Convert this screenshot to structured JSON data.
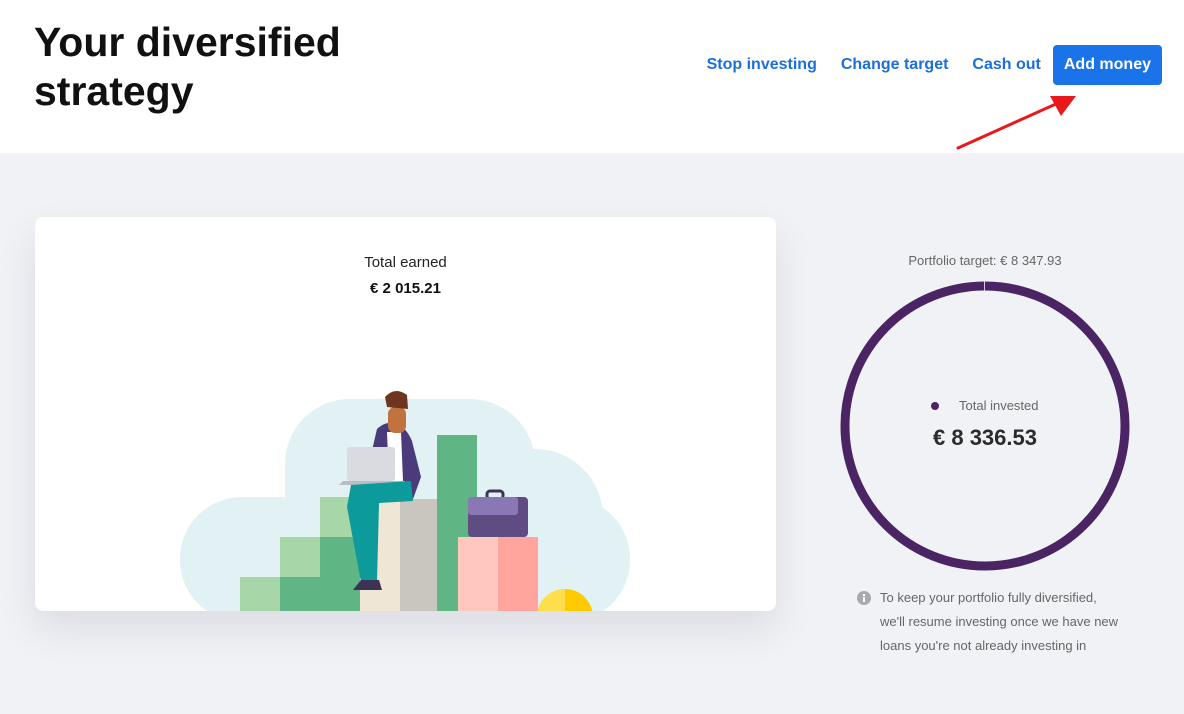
{
  "header": {
    "title": "Your diversified strategy",
    "actions": {
      "stop_investing": "Stop investing",
      "change_target": "Change target",
      "cash_out": "Cash out",
      "add_money": "Add money"
    }
  },
  "earned_card": {
    "label": "Total earned",
    "value": "€ 2 015.21",
    "illustration": "person-sitting-on-bar-chart-with-laptop"
  },
  "portfolio": {
    "target_label": "Portfolio target: € 8 347.93",
    "invested_label": "Total invested",
    "invested_value": "€ 8 336.53",
    "progress_fraction": 0.9986,
    "ring_color": "#4b2563",
    "info_icon": "info-icon",
    "info_text": "To keep your portfolio fully diversified, we'll resume investing once we have new loans you're not already investing in"
  },
  "colors": {
    "accent": "#1a73e8",
    "link": "#1b6fd8",
    "annotation_arrow": "#e8191b"
  }
}
